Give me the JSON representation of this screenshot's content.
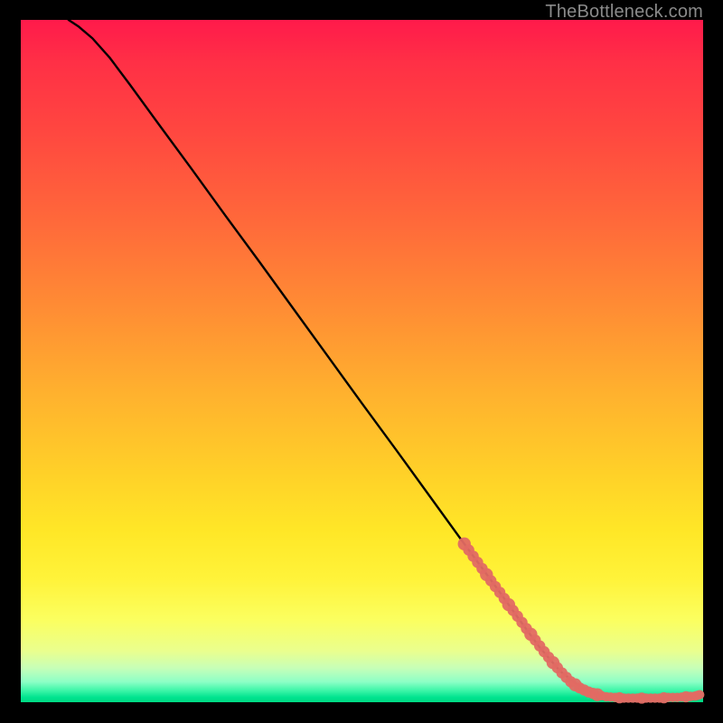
{
  "attribution": "TheBottleneck.com",
  "chart_data": {
    "type": "line",
    "title": "",
    "xlabel": "",
    "ylabel": "",
    "xlim": [
      0,
      100
    ],
    "ylim": [
      0,
      100
    ],
    "grid": false,
    "legend": false,
    "note": "Values are estimated from pixel positions; axes are unlabeled in the source image so x and y are treated as 0–100 percent of the plot area (x left→right, y bottom→top).",
    "series": [
      {
        "name": "curve",
        "style": "line",
        "color": "#000000",
        "x": [
          7.0,
          8.5,
          10.5,
          13.0,
          16.0,
          20.0,
          25.0,
          30.0,
          35.0,
          40.0,
          45.0,
          50.0,
          55.0,
          60.0,
          65.0,
          70.0,
          73.0,
          76.0,
          79.0,
          81.5,
          84.0,
          86.0,
          88.0,
          90.0,
          92.0,
          94.0,
          96.0,
          98.0,
          99.5
        ],
        "y": [
          100.0,
          99.0,
          97.3,
          94.5,
          90.5,
          85.0,
          78.2,
          71.3,
          64.5,
          57.6,
          50.7,
          43.8,
          37.0,
          30.1,
          23.2,
          16.4,
          12.2,
          8.1,
          4.6,
          2.6,
          1.3,
          0.7,
          0.6,
          0.6,
          0.6,
          0.6,
          0.7,
          0.8,
          1.1
        ]
      },
      {
        "name": "highlighted-segment",
        "style": "thick-dotted",
        "color": "#e26a63",
        "x": [
          65.0,
          66.3,
          67.6,
          68.9,
          70.2,
          71.5,
          72.8,
          74.1,
          75.4,
          76.7,
          78.0,
          79.3,
          80.6,
          81.9,
          83.2,
          84.5,
          85.8,
          87.1,
          88.4,
          89.7,
          91.0,
          92.3,
          93.6,
          94.9,
          96.2,
          97.5,
          98.8,
          99.5
        ],
        "y": [
          23.2,
          21.4,
          19.6,
          17.8,
          16.1,
          14.3,
          12.6,
          10.8,
          9.1,
          7.4,
          5.8,
          4.3,
          3.0,
          2.1,
          1.5,
          1.1,
          0.8,
          0.7,
          0.6,
          0.6,
          0.6,
          0.6,
          0.6,
          0.7,
          0.7,
          0.8,
          0.9,
          1.1
        ]
      }
    ]
  }
}
